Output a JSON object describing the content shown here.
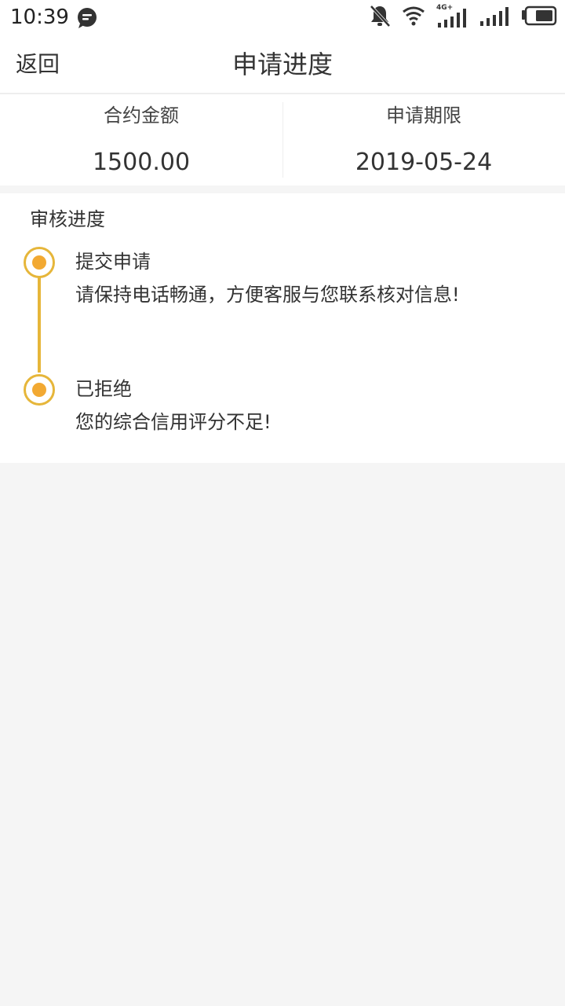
{
  "status_bar": {
    "time": "10:39",
    "network_label": "4G+",
    "icons": [
      "chat-bubble-icon",
      "bell-off-icon",
      "wifi-icon",
      "signal-4g-icon",
      "signal-icon",
      "battery-icon"
    ]
  },
  "nav": {
    "back_label": "返回",
    "title": "申请进度"
  },
  "summary": {
    "amount_label": "合约金额",
    "amount_value": "1500.00",
    "deadline_label": "申请期限",
    "deadline_value": "2019-05-24"
  },
  "progress": {
    "title": "审核进度",
    "steps": [
      {
        "title": "提交申请",
        "desc": "请保持电话畅通，方便客服与您联系核对信息!"
      },
      {
        "title": "已拒绝",
        "desc": "您的综合信用评分不足!"
      }
    ]
  },
  "colors": {
    "accent": "#f2a932",
    "accent_border": "#e6b63a",
    "page_bg": "#f5f5f5"
  }
}
